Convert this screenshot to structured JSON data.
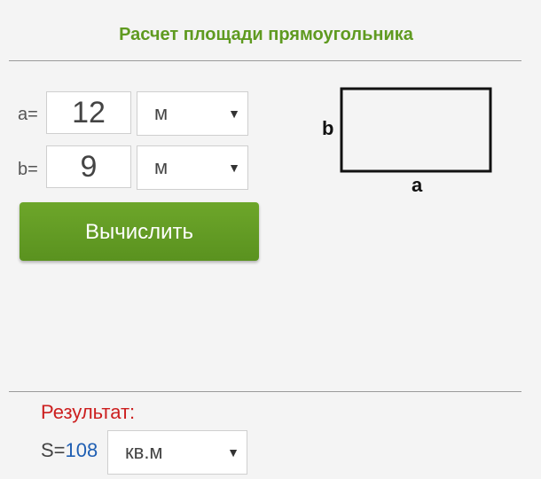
{
  "title": "Расчет площади прямоугольника",
  "inputs": {
    "a": {
      "label": "a=",
      "value": "12",
      "unit": "м"
    },
    "b": {
      "label": "b=",
      "value": "9",
      "unit": "м"
    }
  },
  "calculate_label": "Вычислить",
  "diagram": {
    "side_b": "b",
    "side_a": "a"
  },
  "result": {
    "heading": "Результат:",
    "prefix": "S=",
    "value": "108",
    "unit": "кв.м"
  },
  "colors": {
    "title": "#5f9a20",
    "button": "#64a025",
    "result_heading": "#cc1f1f",
    "result_value": "#1f5fb3"
  },
  "icons": {
    "dropdown": "triangle-down-icon"
  }
}
